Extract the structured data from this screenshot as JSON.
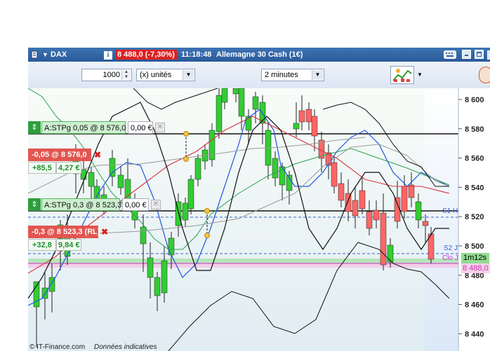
{
  "window": {
    "symbol": "DAX",
    "info_icon": "info-icon",
    "quote": "8 488,0 (-7,30%)",
    "time": "11:18:48",
    "instrument": "Allemagne 30 Cash (1€)"
  },
  "toolbar": {
    "quantity": "1000",
    "unit": "(x) unités",
    "interval": "2 minutes"
  },
  "orders": [
    {
      "label": "A:STPg  0,05 @ 8 576,0",
      "value": "0,00 €"
    },
    {
      "label": "A:STPg  0,3 @ 8 523,3",
      "value": "0,00 €"
    }
  ],
  "positions": [
    {
      "label": "-0,05 @ 8 576,0",
      "pnl_pts": "+85,5",
      "pnl_eur": "4,27 €"
    },
    {
      "label": "-0,3 @ 8 523,3 (RL)",
      "pnl_pts": "+32,8",
      "pnl_eur": "9,84 €"
    }
  ],
  "axis": {
    "ticks": [
      "8 600",
      "8 580",
      "8 560",
      "8 540",
      "8 520",
      "8 500",
      "8 480",
      "8 460",
      "8 440"
    ]
  },
  "levels": {
    "s1": "S1 H",
    "s2": "S2 J",
    "countdown": "1m12s",
    "clo": "Clo J",
    "last": "8 488,0"
  },
  "footer": {
    "copyright": "© IT-Finance.com",
    "note": "Données indicatives"
  },
  "colors": {
    "title_bar": "#2f62a4",
    "bull": "#33cc33",
    "bear": "#ff6666",
    "order_green": "#37b24d",
    "position_red": "#e74c3c"
  }
}
